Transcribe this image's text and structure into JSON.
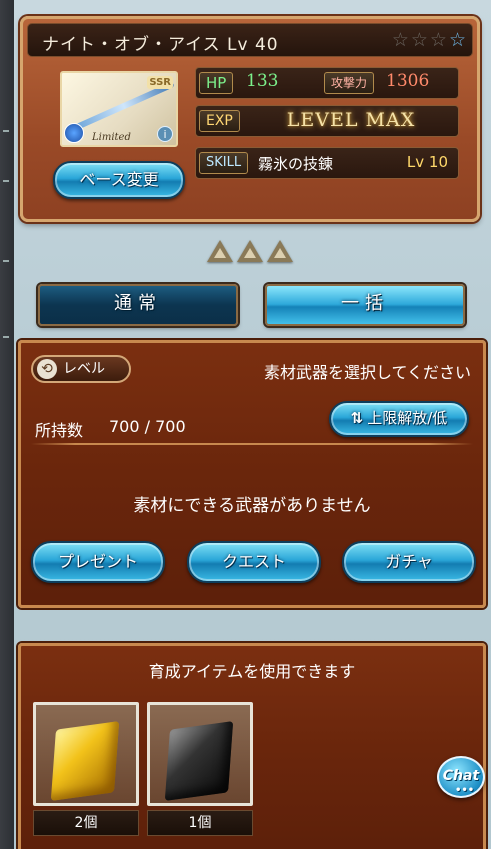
{
  "weapon": {
    "title": "ナイト・オブ・アイス Lv 40",
    "rarity_badge": "SSR",
    "limited_label": "Limited",
    "info_icon": "i",
    "stars": [
      "☆",
      "☆",
      "☆",
      "☆"
    ],
    "stats": {
      "hp_label": "HP",
      "hp_value": "133",
      "atk_label": "攻撃力",
      "atk_value": "1306",
      "exp_label": "EXP",
      "exp_value": "LEVEL MAX",
      "skill_label": "SKILL",
      "skill_name": "霧氷の技錬",
      "skill_level": "Lv 10"
    },
    "base_change_label": "ベース変更"
  },
  "tabs": {
    "normal": "通常",
    "bulk": "一括"
  },
  "material": {
    "sort_label": "レベル",
    "sort_icon": "⟲",
    "select_prompt": "素材武器を選択してください",
    "owned_label": "所持数",
    "owned_value": "700 / 700",
    "uncap_sort_arrows": "⇅",
    "uncap_sort_label": "上限解放/低",
    "empty_message": "素材にできる武器がありません",
    "sources": {
      "present": "プレゼント",
      "quest": "クエスト",
      "gacha": "ガチャ"
    }
  },
  "items": {
    "title": "育成アイテムを使用できます",
    "list": [
      {
        "count": "2個"
      },
      {
        "count": "1個"
      }
    ]
  },
  "chat": {
    "label": "Chat",
    "dots": "•••"
  }
}
